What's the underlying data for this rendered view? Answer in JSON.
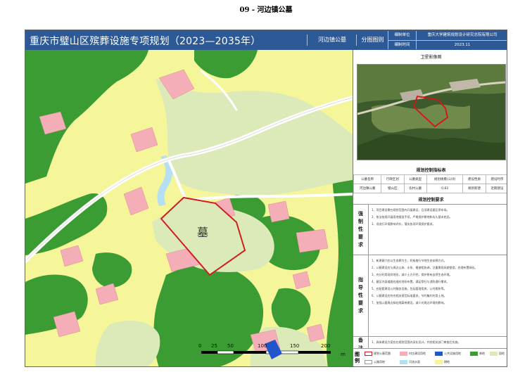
{
  "page_title": "09 - 河边镇公墓",
  "header": {
    "title": "重庆市璧山区殡葬设施专项规划（2023—2035年）",
    "place": "河边镇公墓",
    "figure_type": "分图图则",
    "compile_unit_label": "编制单位",
    "compile_unit_value": "重庆大学建筑规划设计研究总院有限公司",
    "compile_time_label": "编制时间",
    "compile_time_value": "2023.11"
  },
  "map": {
    "cemetery_label": "墓",
    "scale_labels": [
      "0",
      "25",
      "50",
      "100",
      "150",
      "200"
    ],
    "scale_unit": "m",
    "colors": {
      "farmland": "#f5f59a",
      "forest": "#3a9c32",
      "garden": "#dceab9",
      "village": "#f4aeb8",
      "road": "#ffffff",
      "water": "#b5dff2",
      "boundary": "#cc1f1f"
    }
  },
  "satellite": {
    "title": "卫星影像图"
  },
  "indicators": {
    "title": "规划控制指标表",
    "headers": [
      "公墓名称",
      "行政区划",
      "公墓类型",
      "规划规模(公顷)",
      "建设性质",
      "建设时序"
    ],
    "row": [
      "河边镇公墓",
      "璧山区",
      "农村公墓",
      "0.83",
      "规划新建",
      "近期建设"
    ]
  },
  "requirements": {
    "title": "规划控制要求",
    "mandatory_label": "强制性要求",
    "mandatory_items": [
      "1、项目建设需在规划范围内开展建设，且须建设墓区停车场。",
      "2、依法依规开展用地报批手续，严格保护耕地和永久基本农田。",
      "3、须进行环境影响评价，落实各项环境保护要求。"
    ],
    "guidance_label": "指导性要求",
    "guidance_items": [
      "1、新建墓穴应以生态葬为主，积极推行节地生态安葬方式。",
      "2、公墓建设应与周边山体、水系、植被相协调，注重景观风貌塑造，合理布置绿化。",
      "3、充分利用现状地形，减少土方开挖，保护原有自然生态环境。",
      "4、墓区内部道路应顺应地形布置，满足祭扫与消防通行需求。",
      "5、应配套建设公共服务设施，包括管理用房、公共厕所等。",
      "6、公墓建设应符合相关规范标准要求，节约集约利用土地。",
      "7、加强公墓周边绿化隔离带建设，减少对周边环境的影响。"
    ],
    "remarks_label": "备注要求",
    "remarks_items": [
      "1、具体建设方案应在规划范围内深化设计，并经相关部门审查后实施。"
    ]
  },
  "legend": {
    "items": [
      {
        "label": "规划公墓范围",
        "color": "#ffffff",
        "border": "#cc1f1f"
      },
      {
        "label": "村庄建设用地",
        "color": "#f4aeb8"
      },
      {
        "label": "公共设施用地",
        "color": "#2255cc"
      },
      {
        "label": "林地",
        "color": "#3a9c32"
      },
      {
        "label": "园地",
        "color": "#dceab9"
      },
      {
        "label": "公路用地",
        "color": "#ffffff",
        "border": "#999999"
      },
      {
        "label": "河流水面",
        "color": "#b5dff2"
      },
      {
        "label": "耕地",
        "color": "#f5f59a"
      }
    ]
  }
}
